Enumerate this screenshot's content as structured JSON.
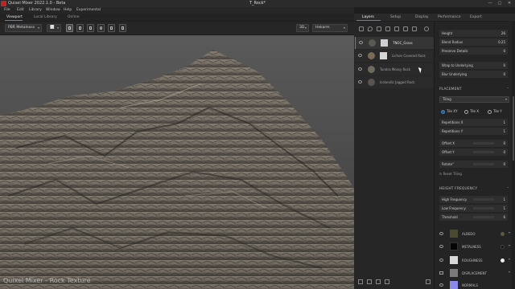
{
  "app": {
    "title": "Quixel Mixer 2022.1.0 - Beta",
    "document_title": "T_Rock*",
    "window_controls": [
      "—",
      "▢",
      "✕"
    ]
  },
  "menu": [
    "File",
    "Edit",
    "Library",
    "Window",
    "Help",
    "Experimental"
  ],
  "viewport_tabs": [
    {
      "label": "Viewport",
      "active": true
    },
    {
      "label": "Local Library",
      "active": false
    },
    {
      "label": "Online",
      "active": false
    }
  ],
  "viewport_toolbar": {
    "shading_mode": "PBR Metalness",
    "view_mode": "3D",
    "environment": "Hekarm"
  },
  "panel_tabs": [
    {
      "label": "Layers",
      "active": true
    },
    {
      "label": "Setup",
      "active": false
    },
    {
      "label": "Display",
      "active": false
    },
    {
      "label": "Performance",
      "active": false
    },
    {
      "label": "Export",
      "active": false
    }
  ],
  "layers": [
    {
      "name": "TNOC_Grass",
      "selected": true,
      "ball_color": "#5b5a52"
    },
    {
      "name": "Lichen Covered Rock",
      "selected": false,
      "ball_color": "#7a6a55"
    },
    {
      "name": "Tundra Mossy Rock",
      "selected": false,
      "ball_color": "#6e6a5e"
    },
    {
      "name": "Icelandic Jagged Rock",
      "selected": false,
      "ball_color": "#5a5450"
    }
  ],
  "properties": {
    "top_rows": [
      {
        "label": "Height",
        "value": "26"
      },
      {
        "label": "Blend Radius",
        "value": "0.25"
      },
      {
        "label": "Preserve Details",
        "value": "0"
      },
      {
        "label": "Wrap to Underlying",
        "value": "0"
      },
      {
        "label": "Blur Underlying",
        "value": "0"
      }
    ],
    "placement_header": "PLACEMENT",
    "placement_mode": "Tiling",
    "tile_options": [
      {
        "label": "Tile XY",
        "selected": true
      },
      {
        "label": "Tile X",
        "selected": false
      },
      {
        "label": "Tile Y",
        "selected": false
      }
    ],
    "placement_rows": [
      {
        "label": "Repetitions X",
        "value": "1"
      },
      {
        "label": "Repetitions Y",
        "value": "1"
      },
      {
        "label": "Offset X",
        "value": "0"
      },
      {
        "label": "Offset Y",
        "value": "0"
      },
      {
        "label": "Rotate°",
        "value": "0"
      }
    ],
    "reset_label": "Reset Tiling",
    "height_frequency_header": "HEIGHT FREQUENCY",
    "frequency_rows": [
      {
        "label": "High Frequency",
        "value": "1"
      },
      {
        "label": "Low Frequency",
        "value": "1"
      },
      {
        "label": "Threshold",
        "value": "6"
      }
    ]
  },
  "channels": [
    {
      "label": "ALBEDO",
      "swatch": "#4a4a30",
      "dot": "#5a5a3a"
    },
    {
      "label": "METALNESS",
      "swatch": "#050505",
      "dot": "#111111"
    },
    {
      "label": "ROUGHNESS",
      "swatch": "#d8d8d8",
      "dot": "#eeeeee"
    },
    {
      "label": "DISPLACEMENT",
      "swatch": "#7a7a7a",
      "dot": ""
    },
    {
      "label": "NORMALS",
      "swatch": "#8a88e8",
      "dot": ""
    }
  ],
  "viewport_watermark": "Quixel Mixer - Rock Texture"
}
